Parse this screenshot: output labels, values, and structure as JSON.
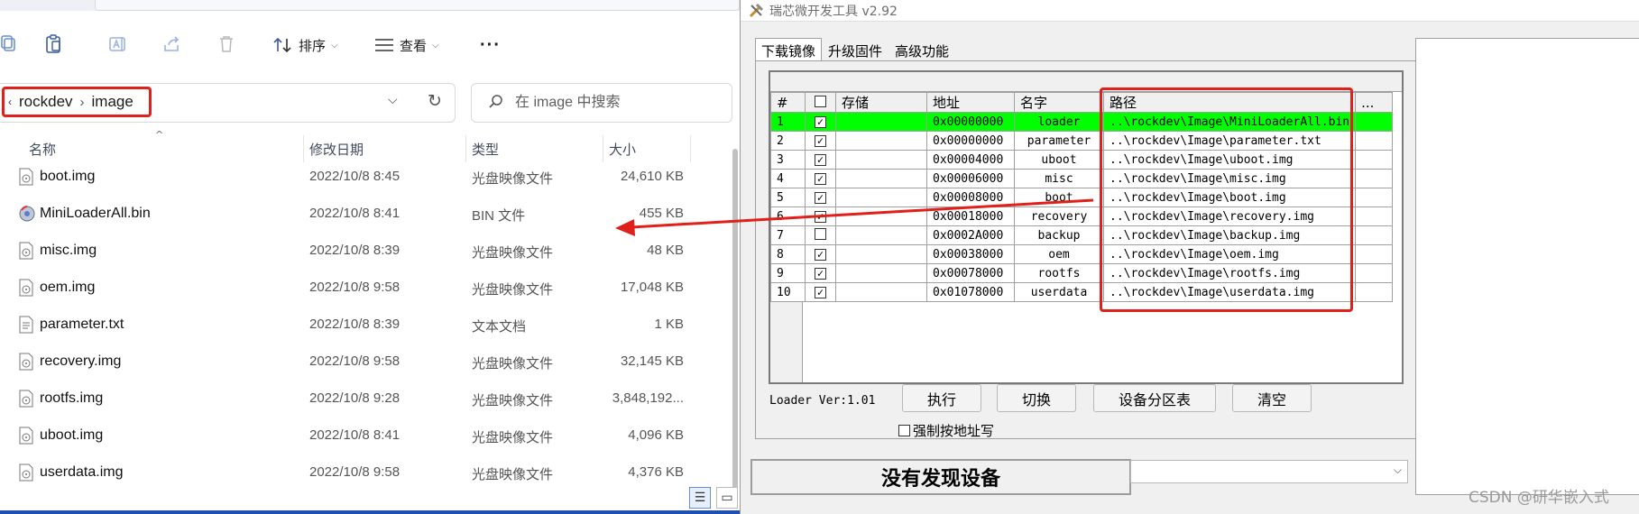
{
  "explorer": {
    "toolbar": {
      "sort_label": "排序",
      "view_label": "查看",
      "more_label": "···"
    },
    "address": {
      "crumbs": [
        "rockdev",
        "image"
      ]
    },
    "search": {
      "placeholder": "在 image 中搜索"
    },
    "columns": {
      "name": "名称",
      "date": "修改日期",
      "type": "类型",
      "size": "大小"
    },
    "files": [
      {
        "name": "boot.img",
        "date": "2022/10/8 8:45",
        "type": "光盘映像文件",
        "size": "24,610 KB",
        "icon": "disc-image-icon"
      },
      {
        "name": "MiniLoaderAll.bin",
        "date": "2022/10/8 8:41",
        "type": "BIN 文件",
        "size": "455 KB",
        "icon": "bin-file-icon"
      },
      {
        "name": "misc.img",
        "date": "2022/10/8 8:39",
        "type": "光盘映像文件",
        "size": "48 KB",
        "icon": "disc-image-icon"
      },
      {
        "name": "oem.img",
        "date": "2022/10/8 9:58",
        "type": "光盘映像文件",
        "size": "17,048 KB",
        "icon": "disc-image-icon"
      },
      {
        "name": "parameter.txt",
        "date": "2022/10/8 8:39",
        "type": "文本文档",
        "size": "1 KB",
        "icon": "text-file-icon"
      },
      {
        "name": "recovery.img",
        "date": "2022/10/8 9:58",
        "type": "光盘映像文件",
        "size": "32,145 KB",
        "icon": "disc-image-icon"
      },
      {
        "name": "rootfs.img",
        "date": "2022/10/8 9:28",
        "type": "光盘映像文件",
        "size": "3,848,192...",
        "icon": "disc-image-icon"
      },
      {
        "name": "uboot.img",
        "date": "2022/10/8 8:41",
        "type": "光盘映像文件",
        "size": "4,096 KB",
        "icon": "disc-image-icon"
      },
      {
        "name": "userdata.img",
        "date": "2022/10/8 9:58",
        "type": "光盘映像文件",
        "size": "4,376 KB",
        "icon": "disc-image-icon"
      }
    ]
  },
  "rk": {
    "title": "瑞芯微开发工具 v2.92",
    "tabs": [
      "下载镜像",
      "升级固件",
      "高级功能"
    ],
    "headers": {
      "num": "#",
      "store": "存储",
      "addr": "地址",
      "name": "名字",
      "path": "路径",
      "more": "..."
    },
    "rows": [
      {
        "num": "1",
        "checked": true,
        "addr": "0x00000000",
        "name": "loader",
        "path": "..\\rockdev\\Image\\MiniLoaderAll.bin",
        "selected": true
      },
      {
        "num": "2",
        "checked": true,
        "addr": "0x00000000",
        "name": "parameter",
        "path": "..\\rockdev\\Image\\parameter.txt",
        "selected": false
      },
      {
        "num": "3",
        "checked": true,
        "addr": "0x00004000",
        "name": "uboot",
        "path": "..\\rockdev\\Image\\uboot.img",
        "selected": false
      },
      {
        "num": "4",
        "checked": true,
        "addr": "0x00006000",
        "name": "misc",
        "path": "..\\rockdev\\Image\\misc.img",
        "selected": false
      },
      {
        "num": "5",
        "checked": true,
        "addr": "0x00008000",
        "name": "boot",
        "path": "..\\rockdev\\Image\\boot.img",
        "selected": false
      },
      {
        "num": "6",
        "checked": true,
        "addr": "0x00018000",
        "name": "recovery",
        "path": "..\\rockdev\\Image\\recovery.img",
        "selected": false
      },
      {
        "num": "7",
        "checked": false,
        "addr": "0x0002A000",
        "name": "backup",
        "path": "..\\rockdev\\Image\\backup.img",
        "selected": false
      },
      {
        "num": "8",
        "checked": true,
        "addr": "0x00038000",
        "name": "oem",
        "path": "..\\rockdev\\Image\\oem.img",
        "selected": false
      },
      {
        "num": "9",
        "checked": true,
        "addr": "0x00078000",
        "name": "rootfs",
        "path": "..\\rockdev\\Image\\rootfs.img",
        "selected": false
      },
      {
        "num": "10",
        "checked": true,
        "addr": "0x01078000",
        "name": "userdata",
        "path": "..\\rockdev\\Image\\userdata.img",
        "selected": false
      }
    ],
    "loader_ver": "Loader Ver:1.01",
    "buttons": {
      "run": "执行",
      "switch": "切换",
      "partition": "设备分区表",
      "clear": "清空"
    },
    "force_label": "强制按地址写",
    "status": "没有发现设备"
  },
  "watermark": "CSDN @研华嵌入式",
  "colors": {
    "highlight_red": "#e0201b",
    "selected_row": "#00ff00",
    "accent_blue": "#1f4fb3"
  }
}
